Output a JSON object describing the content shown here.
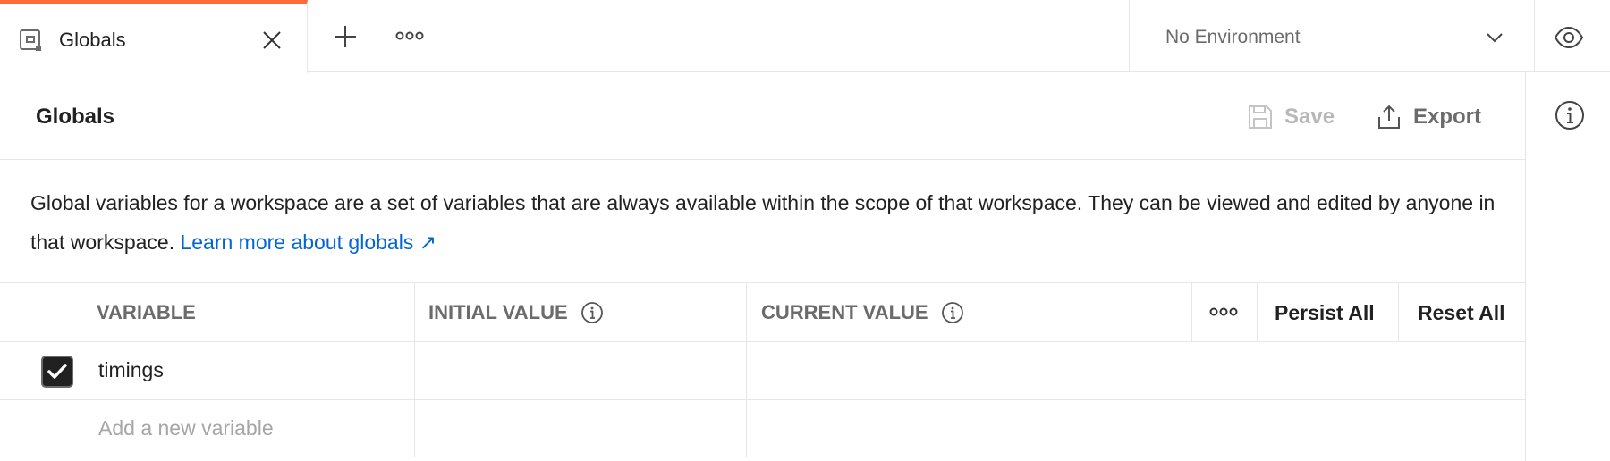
{
  "tab": {
    "label": "Globals",
    "icon": "globals-tab-icon",
    "active_color": "#ff6c37"
  },
  "environment": {
    "selected": "No Environment"
  },
  "header": {
    "title": "Globals",
    "save_label": "Save",
    "export_label": "Export"
  },
  "description": {
    "text": "Global variables for a workspace are a set of variables that are always available within the scope of that workspace. They can be viewed and edited by anyone in that workspace. ",
    "link_text": "Learn more about globals ↗",
    "link_color": "#0265d2"
  },
  "table": {
    "columns": {
      "variable": "VARIABLE",
      "initial_value": "INITIAL VALUE",
      "current_value": "CURRENT VALUE"
    },
    "persist_all": "Persist All",
    "reset_all": "Reset All",
    "rows": [
      {
        "enabled": true,
        "variable": "timings",
        "initial_value": "",
        "current_value": ""
      }
    ],
    "new_variable_placeholder": "Add a new variable"
  }
}
